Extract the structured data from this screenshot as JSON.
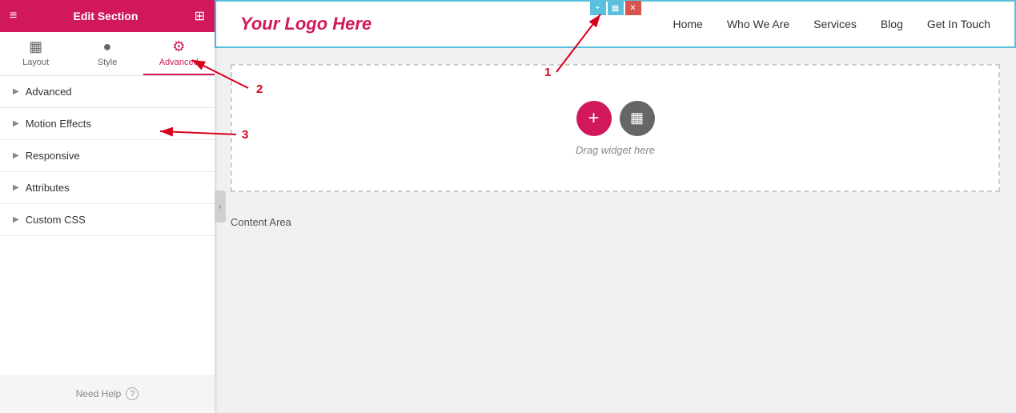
{
  "sidebar": {
    "header": {
      "title": "Edit Section",
      "menu_icon": "≡",
      "grid_icon": "⊞"
    },
    "tabs": [
      {
        "id": "layout",
        "label": "Layout",
        "icon": "▦"
      },
      {
        "id": "style",
        "label": "Style",
        "icon": "●"
      },
      {
        "id": "advanced",
        "label": "Advanced",
        "icon": "⚙"
      }
    ],
    "active_tab": "advanced",
    "sections": [
      {
        "id": "advanced",
        "label": "Advanced"
      },
      {
        "id": "motion-effects",
        "label": "Motion Effects"
      },
      {
        "id": "responsive",
        "label": "Responsive"
      },
      {
        "id": "attributes",
        "label": "Attributes"
      },
      {
        "id": "custom-css",
        "label": "Custom CSS"
      }
    ],
    "footer": {
      "help_label": "Need Help",
      "help_icon": "?"
    }
  },
  "nav": {
    "logo": "Your Logo Here",
    "links": [
      {
        "id": "home",
        "label": "Home"
      },
      {
        "id": "who-we-are",
        "label": "Who We Are"
      },
      {
        "id": "services",
        "label": "Services"
      },
      {
        "id": "blog",
        "label": "Blog"
      },
      {
        "id": "get-in-touch",
        "label": "Get In Touch"
      }
    ]
  },
  "canvas": {
    "drag_widget_text": "Drag widget here",
    "content_area_label": "Content Area",
    "add_button_icon": "+",
    "grid_button_icon": "▦"
  },
  "annotations": {
    "label_1": "1",
    "label_2": "2",
    "label_3": "3"
  },
  "collapse_handle": "‹"
}
